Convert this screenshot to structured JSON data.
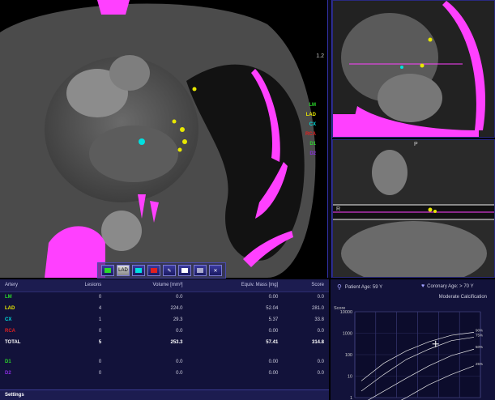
{
  "main_view": {
    "zoom_label": "1.2",
    "legend": [
      {
        "label": "LM",
        "color": "#2bd82b"
      },
      {
        "label": "LAD",
        "color": "#e8e800"
      },
      {
        "label": "CX",
        "color": "#00e0e0"
      },
      {
        "label": "RCA",
        "color": "#e02020"
      },
      {
        "label": "D1",
        "color": "#2bd82b"
      },
      {
        "label": "D2",
        "color": "#8a2be2"
      }
    ]
  },
  "mid_right_view": {
    "label_r": "R",
    "label_p": "P"
  },
  "toolbar": {
    "buttons": [
      "LM",
      "LAD",
      "CX",
      "RCA",
      "pen",
      "view",
      "view2",
      "delete"
    ]
  },
  "table": {
    "headers": [
      "Artery",
      "Lesions",
      "Volume [mm³]",
      "Equiv. Mass [mg]",
      "Score"
    ],
    "rows": [
      {
        "artery": "LM",
        "color": "#2bd82b",
        "lesions": "0",
        "volume": "0.0",
        "mass": "0.00",
        "score": "0.0"
      },
      {
        "artery": "LAD",
        "color": "#e8e800",
        "lesions": "4",
        "volume": "224.0",
        "mass": "52.04",
        "score": "281.0"
      },
      {
        "artery": "CX",
        "color": "#00e0e0",
        "lesions": "1",
        "volume": "29.3",
        "mass": "5.37",
        "score": "33.8"
      },
      {
        "artery": "RCA",
        "color": "#e02020",
        "lesions": "0",
        "volume": "0.0",
        "mass": "0.00",
        "score": "0.0"
      }
    ],
    "total": {
      "artery": "TOTAL",
      "lesions": "5",
      "volume": "253.3",
      "mass": "57.41",
      "score": "314.8"
    },
    "branch_rows": [
      {
        "artery": "D1",
        "color": "#2bd82b",
        "lesions": "0",
        "volume": "0.0",
        "mass": "0.00",
        "score": "0.0"
      },
      {
        "artery": "D2",
        "color": "#8a2be2",
        "lesions": "0",
        "volume": "0.0",
        "mass": "0.00",
        "score": "0.0"
      }
    ],
    "settings_label": "Settings"
  },
  "chart_panel": {
    "patient_age": "Patient Age: 59 Y",
    "coronary_age": "Coronary Age: > 70 Y",
    "calcification": "Moderate Calcification"
  },
  "chart_data": {
    "type": "line",
    "ylabel": "Score",
    "y_scale": "log",
    "y_ticks": [
      "10000",
      "1000",
      "100",
      "10",
      "1"
    ],
    "x_ticks": [],
    "series": [
      {
        "name": "90%",
        "values": [
          6,
          40,
          150,
          400,
          800,
          1100
        ]
      },
      {
        "name": "75%",
        "values": [
          2,
          12,
          60,
          180,
          450,
          650
        ]
      },
      {
        "name": "50%",
        "values": [
          0.5,
          2,
          8,
          30,
          90,
          180
        ]
      },
      {
        "name": "25%",
        "values": [
          0.1,
          0.3,
          1,
          4,
          12,
          30
        ]
      }
    ],
    "patient_point": {
      "x": 3.3,
      "y": 314.8
    },
    "grid": true
  }
}
